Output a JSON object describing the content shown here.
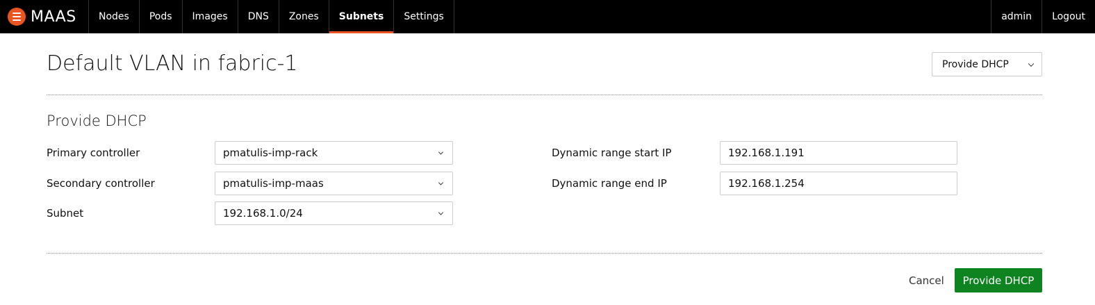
{
  "brand": {
    "name": "MAAS",
    "logo_icon": "menu-icon",
    "accent": "#e95420"
  },
  "nav": {
    "items": [
      {
        "label": "Nodes",
        "active": false
      },
      {
        "label": "Pods",
        "active": false
      },
      {
        "label": "Images",
        "active": false
      },
      {
        "label": "DNS",
        "active": false
      },
      {
        "label": "Zones",
        "active": false
      },
      {
        "label": "Subnets",
        "active": true
      },
      {
        "label": "Settings",
        "active": false
      }
    ],
    "user": "admin",
    "logout": "Logout"
  },
  "header": {
    "title": "Default VLAN in fabric-1",
    "action_select": "Provide DHCP",
    "action_icon": "chevron-down-icon"
  },
  "form": {
    "title": "Provide DHCP",
    "primary_controller": {
      "label": "Primary controller",
      "value": "pmatulis-imp-rack"
    },
    "secondary_controller": {
      "label": "Secondary controller",
      "value": "pmatulis-imp-maas"
    },
    "subnet": {
      "label": "Subnet",
      "value": "192.168.1.0/24"
    },
    "range_start": {
      "label": "Dynamic range start IP",
      "value": "192.168.1.191"
    },
    "range_end": {
      "label": "Dynamic range end IP",
      "value": "192.168.1.254"
    }
  },
  "footer": {
    "cancel": "Cancel",
    "submit": "Provide DHCP",
    "submit_color": "#0e8420"
  }
}
